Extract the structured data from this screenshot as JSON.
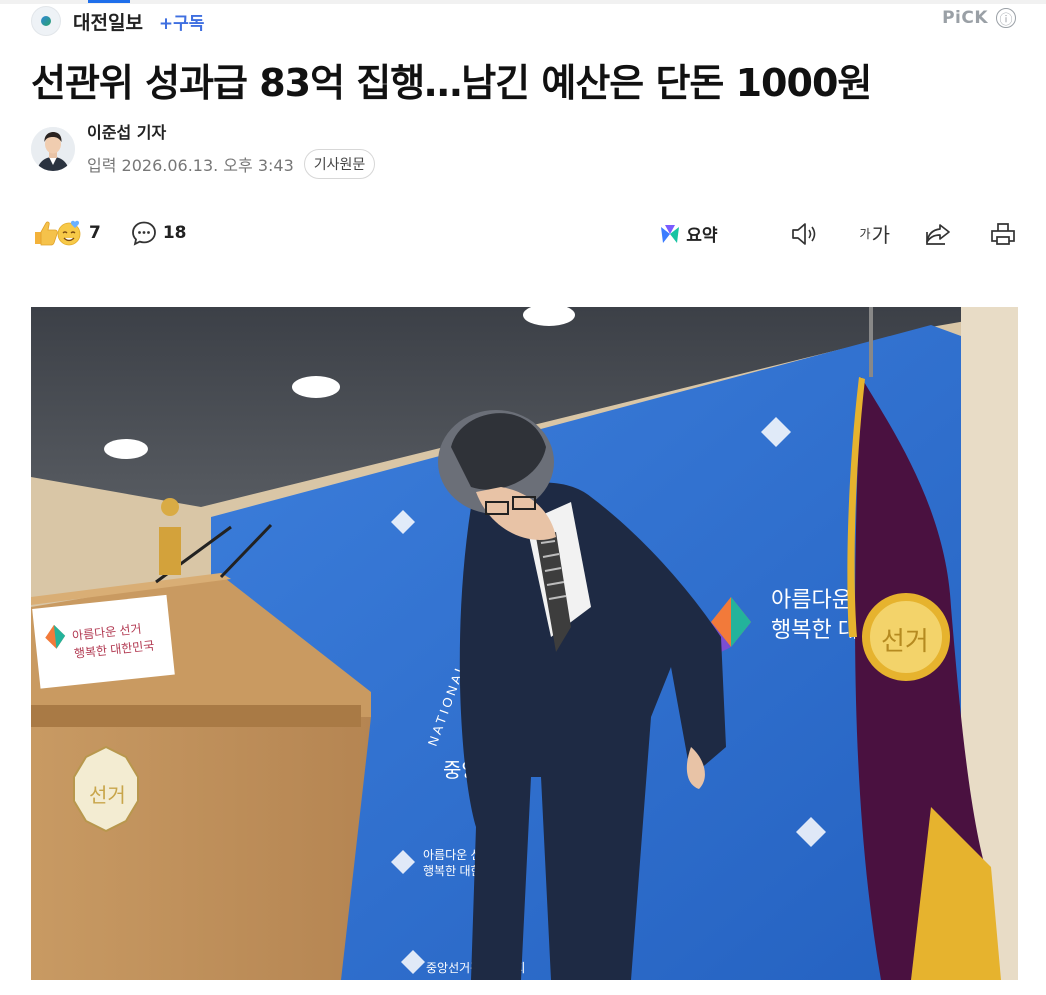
{
  "press": {
    "name": "대전일보",
    "subscribe_label": "+구독"
  },
  "pick": {
    "label": "PiCK",
    "info_icon": "ⓘ"
  },
  "article": {
    "headline": "선관위 성과급 83억 집행…남긴 예산은 단돈 1000원",
    "author": "이준섭 기자",
    "published": "입력 2026.06.13. 오후 3:43",
    "original_button": "기사원문"
  },
  "toolbar": {
    "reaction_count": "7",
    "comment_count": "18",
    "summary_label": "요약",
    "font_label_small": "가",
    "font_label_large": "가"
  },
  "photo": {
    "podium_sign_line1": "아름다운 선거",
    "podium_sign_line2": "행복한 대한민국",
    "podium_emblem": "선거",
    "flag_emblem": "선거",
    "backdrop_slogan_line1": "아름다운",
    "backdrop_slogan_line2": "행복한 대",
    "backdrop_small_line1": "아름다운 선거",
    "backdrop_small_line2": "행복한 대한민국",
    "backdrop_org": "중앙선거관리위원회",
    "backdrop_org_partial": "중앙선거",
    "backdrop_national": "NATIONAL"
  },
  "colors": {
    "accent": "#3f6fe0",
    "backdrop_blue": "#2f6fcf",
    "flag_purple": "#4a1140",
    "gold": "#e6b32e"
  }
}
